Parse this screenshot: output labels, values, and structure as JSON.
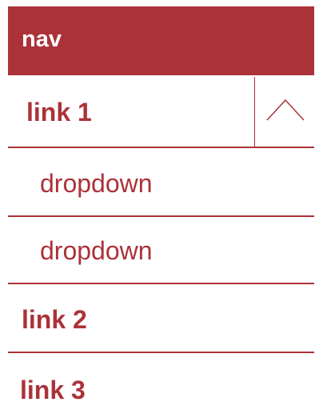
{
  "nav": {
    "title": "nav",
    "accent_color": "#ac3239",
    "items": [
      {
        "label": "link 1",
        "expanded": true,
        "toggle_icon": "chevron-up-icon",
        "children": [
          {
            "label": "dropdown"
          },
          {
            "label": "dropdown"
          }
        ]
      },
      {
        "label": "link 2"
      },
      {
        "label": "link 3"
      }
    ]
  }
}
